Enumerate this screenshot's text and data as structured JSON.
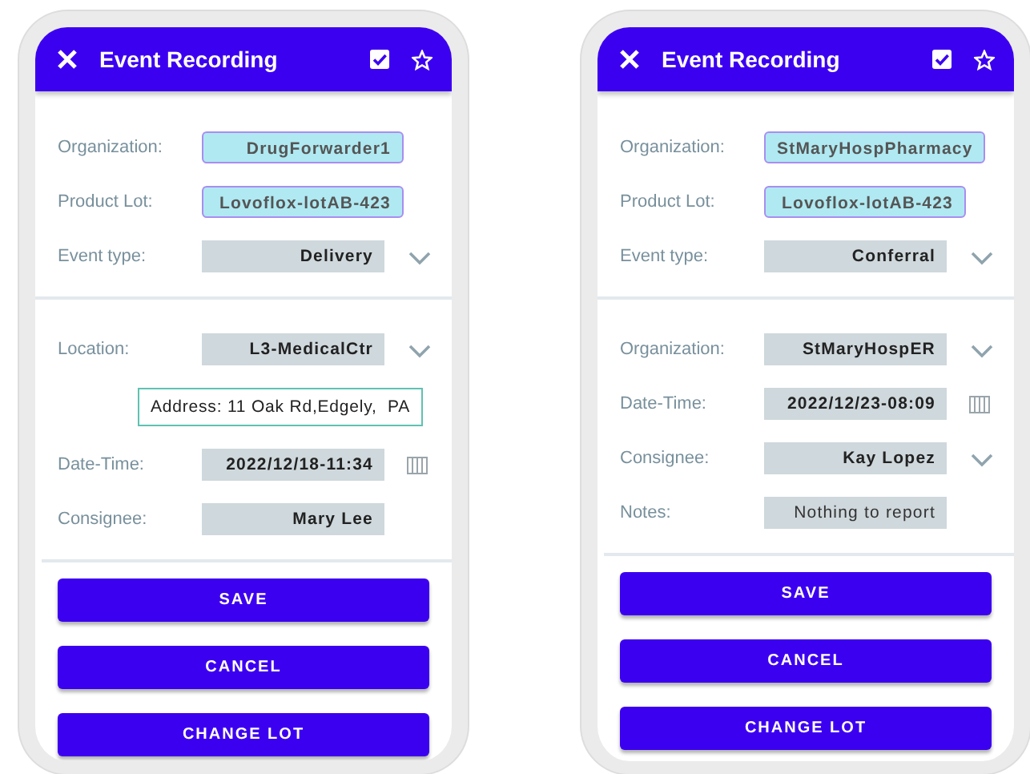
{
  "screens": [
    {
      "title": "Event Recording",
      "top_fields": [
        {
          "label": "Organization:",
          "value": "DrugForwarder1",
          "kind": "highlight"
        },
        {
          "label": "Product Lot:",
          "value": "Lovoflox-lotAB-423",
          "kind": "highlight"
        },
        {
          "label": "Event type:",
          "value": "Delivery",
          "kind": "select"
        }
      ],
      "detail_fields": [
        {
          "label": "Location:",
          "value": "L3-MedicalCtr",
          "kind": "select"
        },
        {
          "value": "Address: 11 Oak Rd,Edgely,  PA",
          "kind": "address"
        },
        {
          "label": "Date-Time:",
          "value": "2022/12/18-11:34",
          "kind": "date"
        },
        {
          "label": "Consignee:",
          "value": "Mary Lee",
          "kind": "text"
        }
      ],
      "buttons": [
        "SAVE",
        "CANCEL",
        "CHANGE LOT"
      ]
    },
    {
      "title": "Event Recording",
      "top_fields": [
        {
          "label": "Organization:",
          "value": "StMaryHospPharmacy",
          "kind": "highlight"
        },
        {
          "label": "Product Lot:",
          "value": "Lovoflox-lotAB-423",
          "kind": "highlight"
        },
        {
          "label": "Event type:",
          "value": "Conferral",
          "kind": "select"
        }
      ],
      "detail_fields": [
        {
          "label": "Organization:",
          "value": "StMaryHospER",
          "kind": "select"
        },
        {
          "label": "Date-Time:",
          "value": "2022/12/23-08:09",
          "kind": "date"
        },
        {
          "label": "Consignee:",
          "value": "Kay Lopez",
          "kind": "select"
        },
        {
          "label": "Notes:",
          "value": "Nothing to report",
          "kind": "plain"
        }
      ],
      "buttons": [
        "SAVE",
        "CANCEL",
        "CHANGE LOT"
      ]
    }
  ]
}
